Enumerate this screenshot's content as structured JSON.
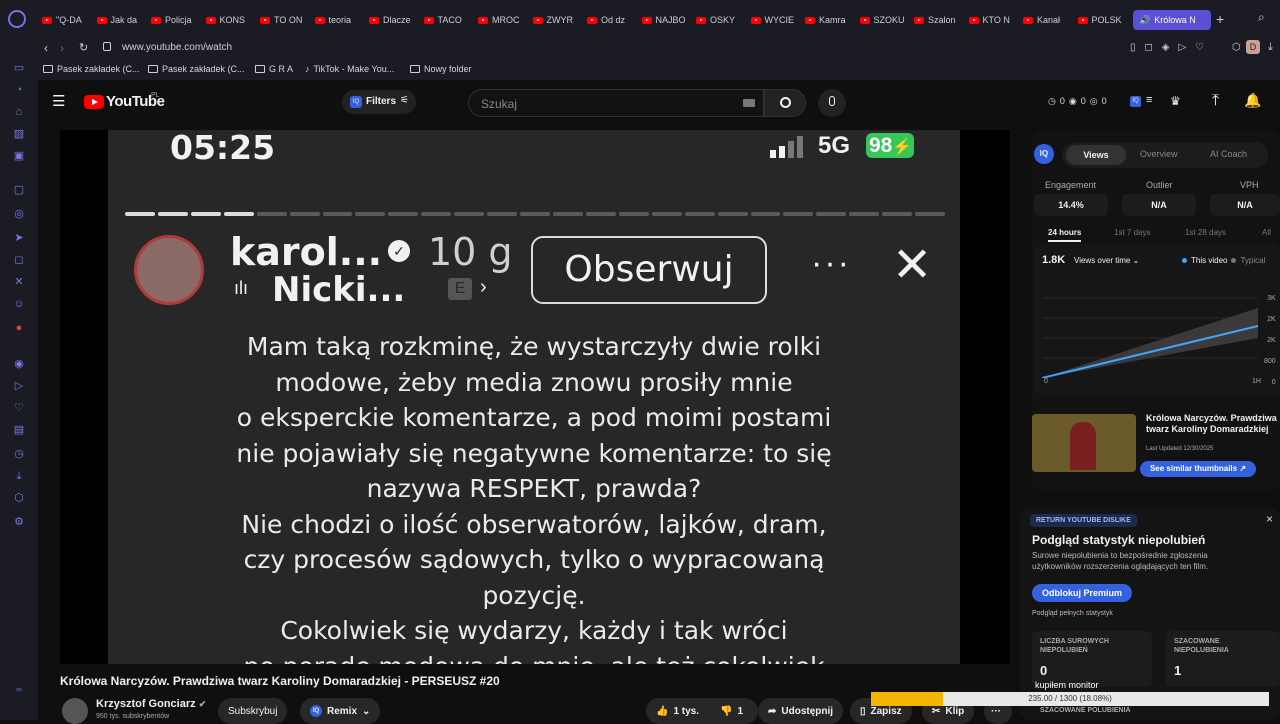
{
  "browser": {
    "tabs": [
      "\"Q-DA",
      "Jak da",
      "Policja",
      "KONS",
      "TO ON",
      "teoria",
      "Dlacze",
      "TACO",
      "MROC",
      "ZWYR",
      "Od dz",
      "NAJBO",
      "OSKY",
      "WYCIE",
      "Kamra",
      "SZOKU",
      "Szalon",
      "KTO N",
      "Kanał",
      "POLSK"
    ],
    "active_tab": "Królowa N",
    "url": "www.youtube.com/watch",
    "bookmarks": [
      "Pasek zakładek (C...",
      "Pasek zakładek (C...",
      "G R A",
      "TikTok - Make You...",
      "Nowy folder"
    ],
    "profile_initial": "D"
  },
  "header": {
    "logo_text": "YouTube",
    "logo_region": "PL",
    "filters_label": "Filters",
    "iq_badge": "IQ",
    "search_placeholder": "Szukaj",
    "stats": [
      "0",
      "0",
      "0"
    ]
  },
  "video": {
    "time": "05:25",
    "signal": "5G",
    "battery": "98",
    "username": "karol...",
    "age": "10 g",
    "song": "Nicki...",
    "explicit": "E",
    "follow_button": "Obserwuj",
    "progress_done": 4,
    "progress_total": 25,
    "lines": [
      "Mam taką rozkminę, że wystarczyły dwie rolki",
      "modowe, żeby media znowu prosiły mnie",
      "o eksperckie komentarze, a pod moimi postami",
      "nie pojawiały się negatywne komentarze: to się",
      "nazywa RESPEKT, prawda?",
      "Nie chodzi o ilość obserwatorów, lajków, dram,",
      "czy procesów sądowych, tylko o wypracowaną",
      "pozycję.",
      "Cokolwiek się wydarzy, każdy i tak wróci",
      "po poradę modową do mnie, ale też cokolwiek"
    ]
  },
  "title": "Królowa Narcyzów. Prawdziwa twarz Karoliny Domaradzkiej - PERSEUSZ #20",
  "channel": {
    "name": "Krzysztof Gonciarz",
    "subscribers": "950 tys. subskrybentów",
    "subscribe": "Subskrybuj",
    "remix": "Remix"
  },
  "actions": {
    "likes": "1 tys.",
    "dislikes": "1",
    "share": "Udostępnij",
    "save": "Zapisz",
    "clip": "Klip"
  },
  "iq_panel": {
    "badge": "IQ",
    "tabs": [
      "Views",
      "Overview",
      "AI Coach"
    ],
    "metrics": [
      {
        "label": "Engagement",
        "value": "14.4%"
      },
      {
        "label": "Outlier",
        "value": "N/A"
      },
      {
        "label": "VPH",
        "value": "N/A"
      }
    ],
    "ranges": [
      "24 hours",
      "1st 7 days",
      "1st 28 days",
      "All"
    ],
    "views": "1.8K",
    "dropdown": "Views over time",
    "legend": [
      "This video",
      "Typical"
    ],
    "y_ticks": [
      "3K",
      "2K",
      "2K",
      "800",
      "0"
    ],
    "x_ticks": [
      "0",
      "1H"
    ],
    "thumb_title": "Królowa Narcyzów. Prawdziwa twarz Karoliny Domaradzkiej",
    "last_updated": "Last Updated 12/30/2025",
    "similar_btn": "See similar thumbnails"
  },
  "ryd": {
    "badge": "RETURN YOUTUBE DISLIKE",
    "title": "Podgląd statystyk niepolubień",
    "desc": "Surowe niepolubienia to bezpośrednie zgłoszenia użytkowników rozszerzenia oglądających ten film.",
    "unlock": "Odblokuj Premium",
    "full_stats": "Podgląd pełnych statystyk",
    "card1_label": "LICZBA SUROWYCH NIEPOLUBIEŃ",
    "card1_value": "0",
    "card2_label": "SZACOWANE NIEPOLUBIENIA",
    "card2_value": "1",
    "card3_label": "SZACOWANE POLUBIENIA",
    "close": "×"
  },
  "download": {
    "label": "kupiłem monitor",
    "progress": "235.00 / 1300 (18.08%)",
    "fraction": 0.1808
  }
}
